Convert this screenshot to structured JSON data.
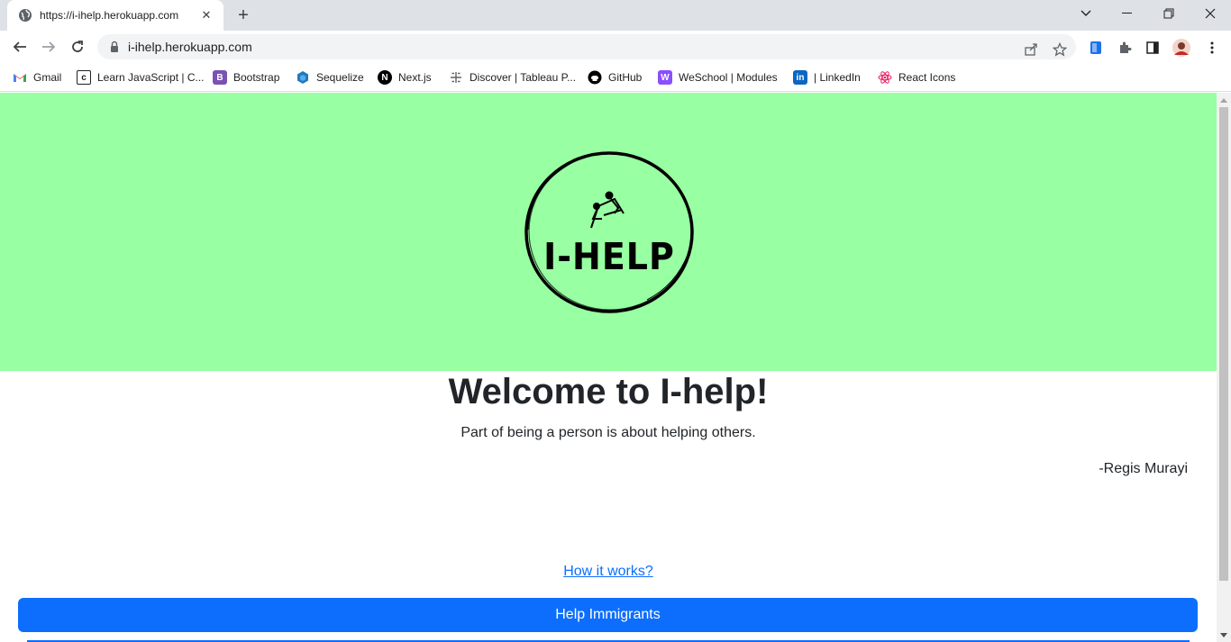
{
  "browser": {
    "tab_title": "https://i-ihelp.herokuapp.com",
    "url": "i-ihelp.herokuapp.com",
    "bookmarks": [
      {
        "label": "Gmail",
        "icon": "gmail-icon"
      },
      {
        "label": "Learn JavaScript | C...",
        "icon": "codecademy-icon"
      },
      {
        "label": "Bootstrap",
        "icon": "bootstrap-icon"
      },
      {
        "label": "Sequelize",
        "icon": "sequelize-icon"
      },
      {
        "label": "Next.js",
        "icon": "nextjs-icon"
      },
      {
        "label": "Discover | Tableau P...",
        "icon": "tableau-icon"
      },
      {
        "label": "GitHub",
        "icon": "github-icon"
      },
      {
        "label": "WeSchool | Modules",
        "icon": "weschool-icon"
      },
      {
        "label": "| LinkedIn",
        "icon": "linkedin-icon"
      },
      {
        "label": "React Icons",
        "icon": "react-icon"
      }
    ]
  },
  "page": {
    "logo_text": "I-HELP",
    "welcome": "Welcome to I-help!",
    "quote": "Part of being a person is about helping others.",
    "author": "-Regis Murayi",
    "how_link": "How it works?",
    "help_button": "Help Immigrants"
  },
  "colors": {
    "hero_bg": "#99ffa3",
    "primary": "#0d6efd",
    "text": "#212529"
  }
}
